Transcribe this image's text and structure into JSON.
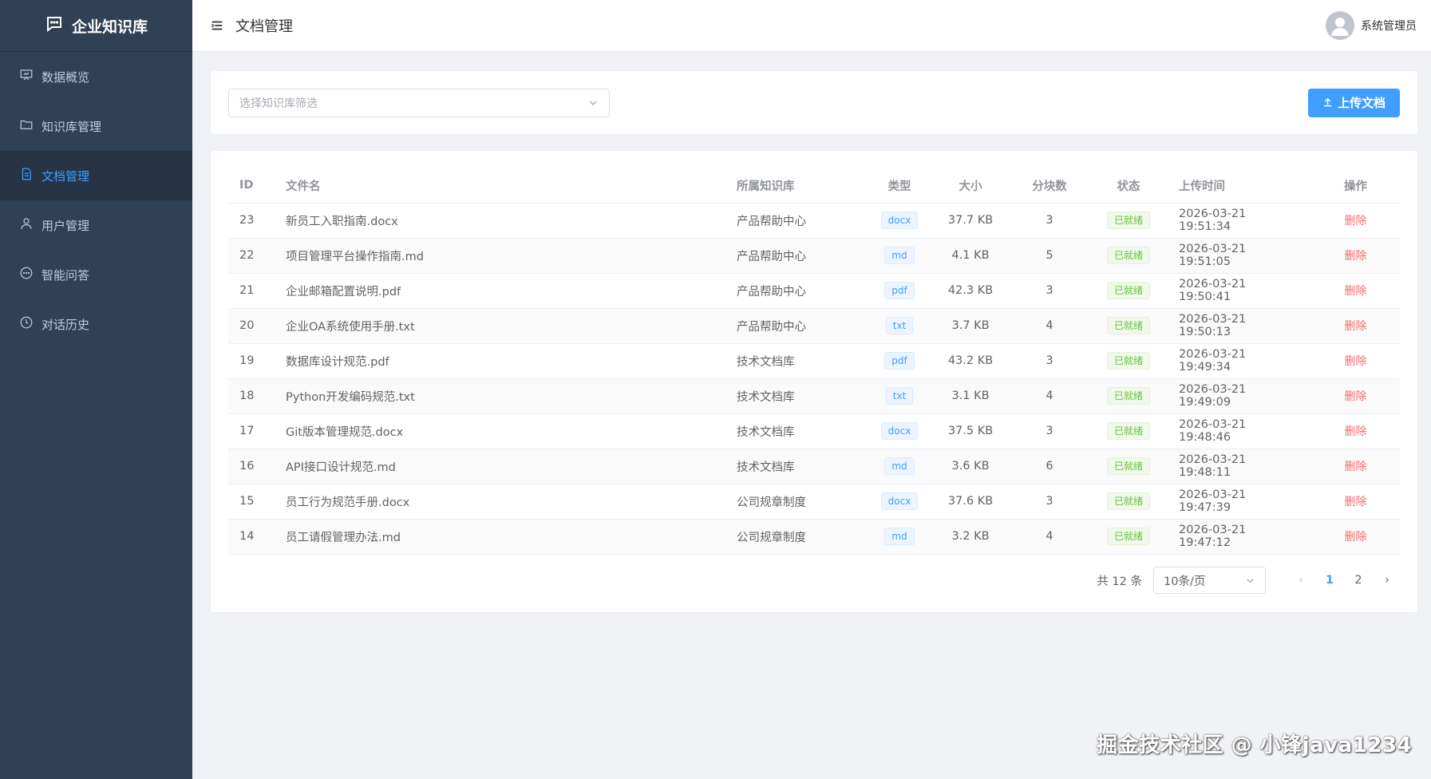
{
  "app": {
    "title": "企业知识库"
  },
  "sidebar": {
    "items": [
      {
        "label": "数据概览",
        "icon": "presentation-icon"
      },
      {
        "label": "知识库管理",
        "icon": "folder-icon"
      },
      {
        "label": "文档管理",
        "icon": "document-icon",
        "active": true
      },
      {
        "label": "用户管理",
        "icon": "user-icon"
      },
      {
        "label": "智能问答",
        "icon": "chat-icon"
      },
      {
        "label": "对话历史",
        "icon": "clock-icon"
      }
    ]
  },
  "header": {
    "title": "文档管理",
    "user_name": "系统管理员"
  },
  "filter": {
    "placeholder": "选择知识库筛选",
    "upload_label": "上传文档"
  },
  "table": {
    "columns": [
      "ID",
      "文件名",
      "所属知识库",
      "类型",
      "大小",
      "分块数",
      "状态",
      "上传时间",
      "操作"
    ],
    "rows": [
      {
        "id": "23",
        "name": "新员工入职指南.docx",
        "kb": "产品帮助中心",
        "type": "docx",
        "size": "37.7 KB",
        "chunks": "3",
        "status": "已就绪",
        "time": "2026-03-21 19:51:34",
        "action": "删除"
      },
      {
        "id": "22",
        "name": "项目管理平台操作指南.md",
        "kb": "产品帮助中心",
        "type": "md",
        "size": "4.1 KB",
        "chunks": "5",
        "status": "已就绪",
        "time": "2026-03-21 19:51:05",
        "action": "删除"
      },
      {
        "id": "21",
        "name": "企业邮箱配置说明.pdf",
        "kb": "产品帮助中心",
        "type": "pdf",
        "size": "42.3 KB",
        "chunks": "3",
        "status": "已就绪",
        "time": "2026-03-21 19:50:41",
        "action": "删除"
      },
      {
        "id": "20",
        "name": "企业OA系统使用手册.txt",
        "kb": "产品帮助中心",
        "type": "txt",
        "size": "3.7 KB",
        "chunks": "4",
        "status": "已就绪",
        "time": "2026-03-21 19:50:13",
        "action": "删除"
      },
      {
        "id": "19",
        "name": "数据库设计规范.pdf",
        "kb": "技术文档库",
        "type": "pdf",
        "size": "43.2 KB",
        "chunks": "3",
        "status": "已就绪",
        "time": "2026-03-21 19:49:34",
        "action": "删除"
      },
      {
        "id": "18",
        "name": "Python开发编码规范.txt",
        "kb": "技术文档库",
        "type": "txt",
        "size": "3.1 KB",
        "chunks": "4",
        "status": "已就绪",
        "time": "2026-03-21 19:49:09",
        "action": "删除"
      },
      {
        "id": "17",
        "name": "Git版本管理规范.docx",
        "kb": "技术文档库",
        "type": "docx",
        "size": "37.5 KB",
        "chunks": "3",
        "status": "已就绪",
        "time": "2026-03-21 19:48:46",
        "action": "删除"
      },
      {
        "id": "16",
        "name": "API接口设计规范.md",
        "kb": "技术文档库",
        "type": "md",
        "size": "3.6 KB",
        "chunks": "6",
        "status": "已就绪",
        "time": "2026-03-21 19:48:11",
        "action": "删除"
      },
      {
        "id": "15",
        "name": "员工行为规范手册.docx",
        "kb": "公司规章制度",
        "type": "docx",
        "size": "37.6 KB",
        "chunks": "3",
        "status": "已就绪",
        "time": "2026-03-21 19:47:39",
        "action": "删除"
      },
      {
        "id": "14",
        "name": "员工请假管理办法.md",
        "kb": "公司规章制度",
        "type": "md",
        "size": "3.2 KB",
        "chunks": "4",
        "status": "已就绪",
        "time": "2026-03-21 19:47:12",
        "action": "删除"
      }
    ]
  },
  "pagination": {
    "total_text": "共 12 条",
    "page_size": "10条/页",
    "pages": [
      "1",
      "2"
    ],
    "current": "1"
  },
  "watermark": "掘金技术社区 @ 小锋java1234",
  "colors": {
    "sidebar_bg": "#304156",
    "accent": "#409eff",
    "danger": "#f56c6c",
    "success": "#67c23a"
  }
}
